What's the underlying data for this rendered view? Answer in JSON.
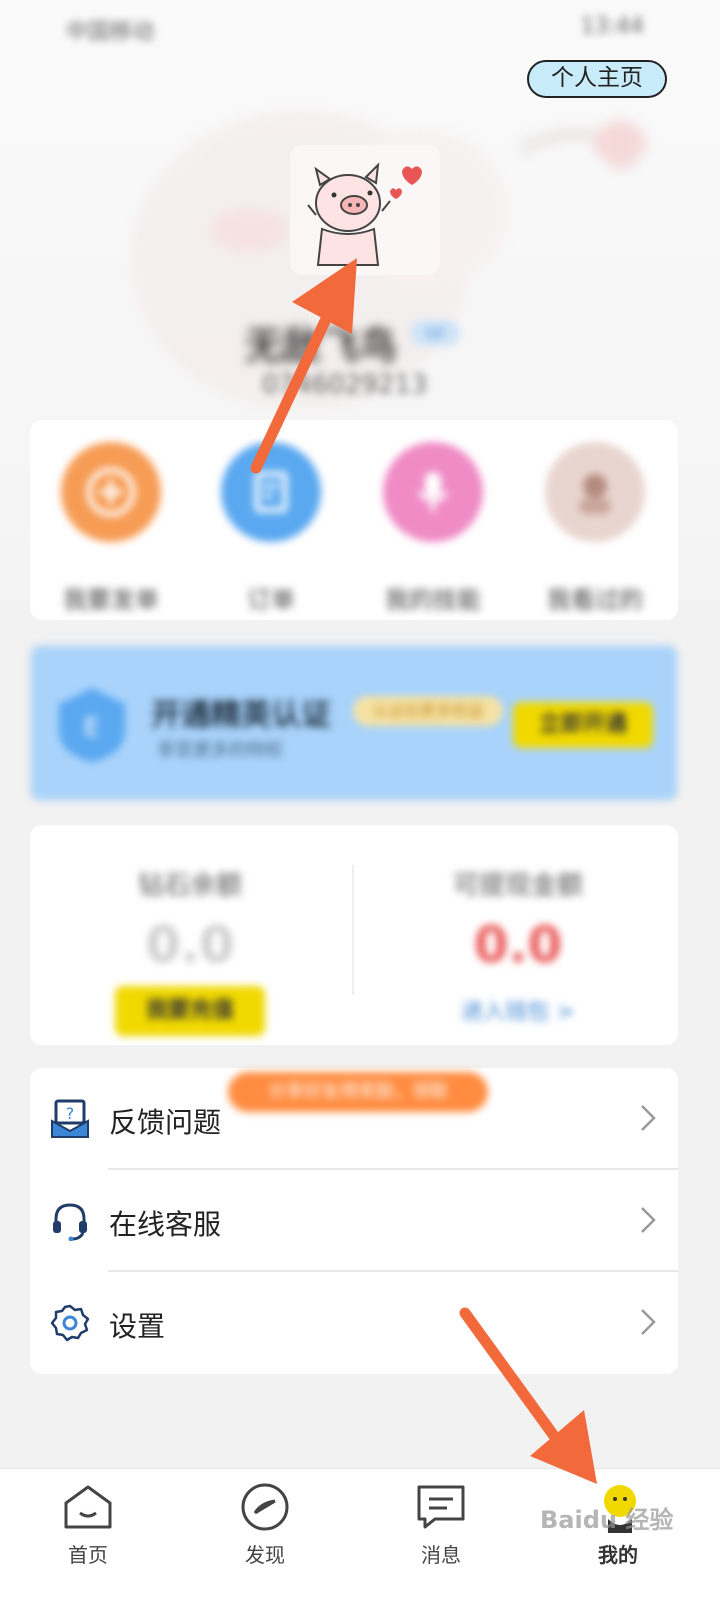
{
  "status_bar": {
    "left": "中国移动",
    "right": "13:44"
  },
  "header": {
    "profile_button": "个人主页"
  },
  "user": {
    "name": "无敌飞鸟",
    "badge": "LV",
    "id": "0746029213"
  },
  "quick_actions": [
    {
      "label": "我要发单",
      "icon": "plus-icon",
      "color": "#f79c55"
    },
    {
      "label": "订单",
      "icon": "document-icon",
      "color": "#5aa8f0"
    },
    {
      "label": "我的技能",
      "icon": "microphone-icon",
      "color": "#f08bc6"
    },
    {
      "label": "我看过的",
      "icon": "photo-icon",
      "color": "#e9d5cf"
    }
  ],
  "vip_banner": {
    "title": "开通精英认证",
    "tag": "认证后更多权益",
    "subtitle": "享受更多的特权",
    "button": "立即开通"
  },
  "wallet": {
    "balance_label": "钻石余额",
    "balance_value": "0.0",
    "recharge_button": "我要充值",
    "withdraw_label": "可提现金额",
    "withdraw_value": "0.0",
    "withdraw_link": "进入钱包 >"
  },
  "promo_pill": "分享好友得奖励，领取",
  "menu": [
    {
      "label": "反馈问题",
      "icon": "feedback-icon"
    },
    {
      "label": "在线客服",
      "icon": "headset-icon"
    },
    {
      "label": "设置",
      "icon": "gear-icon"
    }
  ],
  "tabbar": [
    {
      "label": "首页",
      "icon": "home-icon"
    },
    {
      "label": "发现",
      "icon": "compass-icon"
    },
    {
      "label": "消息",
      "icon": "message-icon"
    },
    {
      "label": "我的",
      "icon": "profile-icon",
      "active": true
    }
  ],
  "watermark": "Baidu 经验",
  "colors": {
    "accent_yellow": "#f1d900",
    "annotation_arrow": "#f26a3b",
    "vip_blue": "#a9d3fb"
  }
}
